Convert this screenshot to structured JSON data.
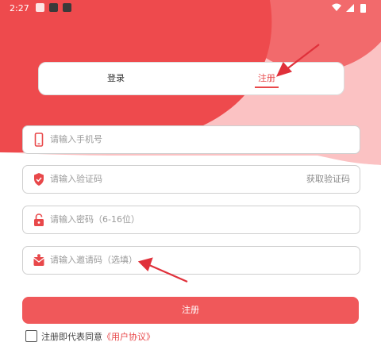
{
  "status_bar": {
    "time": "2:27"
  },
  "tabs": {
    "login": "登录",
    "register": "注册"
  },
  "form": {
    "phone_placeholder": "请输入手机号",
    "code_placeholder": "请输入验证码",
    "get_code": "获取验证码",
    "password_placeholder": "请输入密码（6-16位）",
    "invite_placeholder": "请输入邀请码（选填）"
  },
  "submit_label": "注册",
  "agreement": {
    "prefix": "注册即代表同意",
    "link": "《用户协议》"
  },
  "colors": {
    "primary": "#f0585a",
    "accent": "#e8484a",
    "bg_light": "#f9b5b6"
  },
  "icons": [
    "phone-icon",
    "shield-icon",
    "lock-icon",
    "invite-icon",
    "wifi-icon",
    "signal-icon",
    "battery-icon"
  ]
}
